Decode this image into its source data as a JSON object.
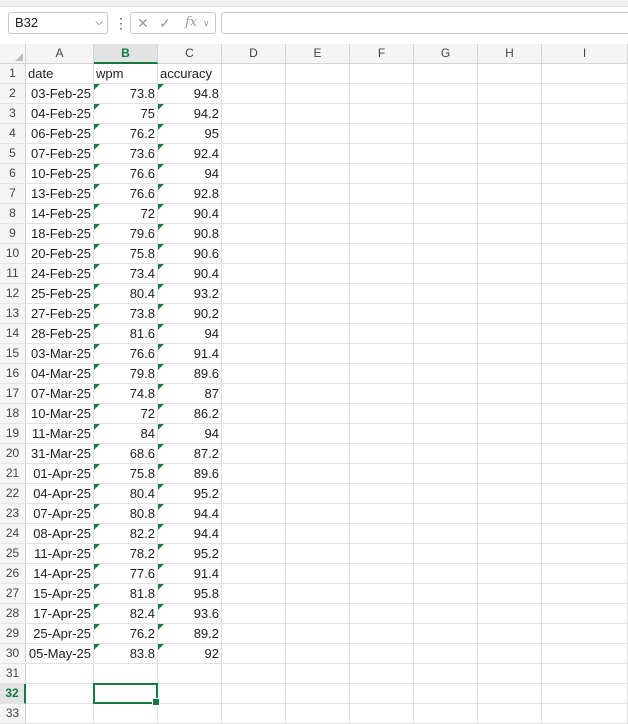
{
  "name_box": "B32",
  "formula_content": "",
  "icons": {
    "cancel": "cancel-icon",
    "enter": "check-icon",
    "function": "fx-icon"
  },
  "columns": [
    "A",
    "B",
    "C",
    "D",
    "E",
    "F",
    "G",
    "H",
    "I"
  ],
  "selected_column": "B",
  "selected_row": 32,
  "header": [
    "date",
    "wpm",
    "accuracy"
  ],
  "rows": [
    [
      "03-Feb-25",
      "73.8",
      "94.8"
    ],
    [
      "04-Feb-25",
      "75",
      "94.2"
    ],
    [
      "06-Feb-25",
      "76.2",
      "95"
    ],
    [
      "07-Feb-25",
      "73.6",
      "92.4"
    ],
    [
      "10-Feb-25",
      "76.6",
      "94"
    ],
    [
      "13-Feb-25",
      "76.6",
      "92.8"
    ],
    [
      "14-Feb-25",
      "72",
      "90.4"
    ],
    [
      "18-Feb-25",
      "79.6",
      "90.8"
    ],
    [
      "20-Feb-25",
      "75.8",
      "90.6"
    ],
    [
      "24-Feb-25",
      "73.4",
      "90.4"
    ],
    [
      "25-Feb-25",
      "80.4",
      "93.2"
    ],
    [
      "27-Feb-25",
      "73.8",
      "90.2"
    ],
    [
      "28-Feb-25",
      "81.6",
      "94"
    ],
    [
      "03-Mar-25",
      "76.6",
      "91.4"
    ],
    [
      "04-Mar-25",
      "79.8",
      "89.6"
    ],
    [
      "07-Mar-25",
      "74.8",
      "87"
    ],
    [
      "10-Mar-25",
      "72",
      "86.2"
    ],
    [
      "11-Mar-25",
      "84",
      "94"
    ],
    [
      "31-Mar-25",
      "68.6",
      "87.2"
    ],
    [
      "01-Apr-25",
      "75.8",
      "89.6"
    ],
    [
      "04-Apr-25",
      "80.4",
      "95.2"
    ],
    [
      "07-Apr-25",
      "80.8",
      "94.4"
    ],
    [
      "08-Apr-25",
      "82.2",
      "94.4"
    ],
    [
      "11-Apr-25",
      "78.2",
      "95.2"
    ],
    [
      "14-Apr-25",
      "77.6",
      "91.4"
    ],
    [
      "15-Apr-25",
      "81.8",
      "95.8"
    ],
    [
      "17-Apr-25",
      "82.4",
      "93.6"
    ],
    [
      "25-Apr-25",
      "76.2",
      "89.2"
    ],
    [
      "05-May-25",
      "83.8",
      "92"
    ]
  ],
  "total_rows": 33,
  "colors": {
    "accent": "#107c41",
    "flag": "#1e7e34"
  }
}
